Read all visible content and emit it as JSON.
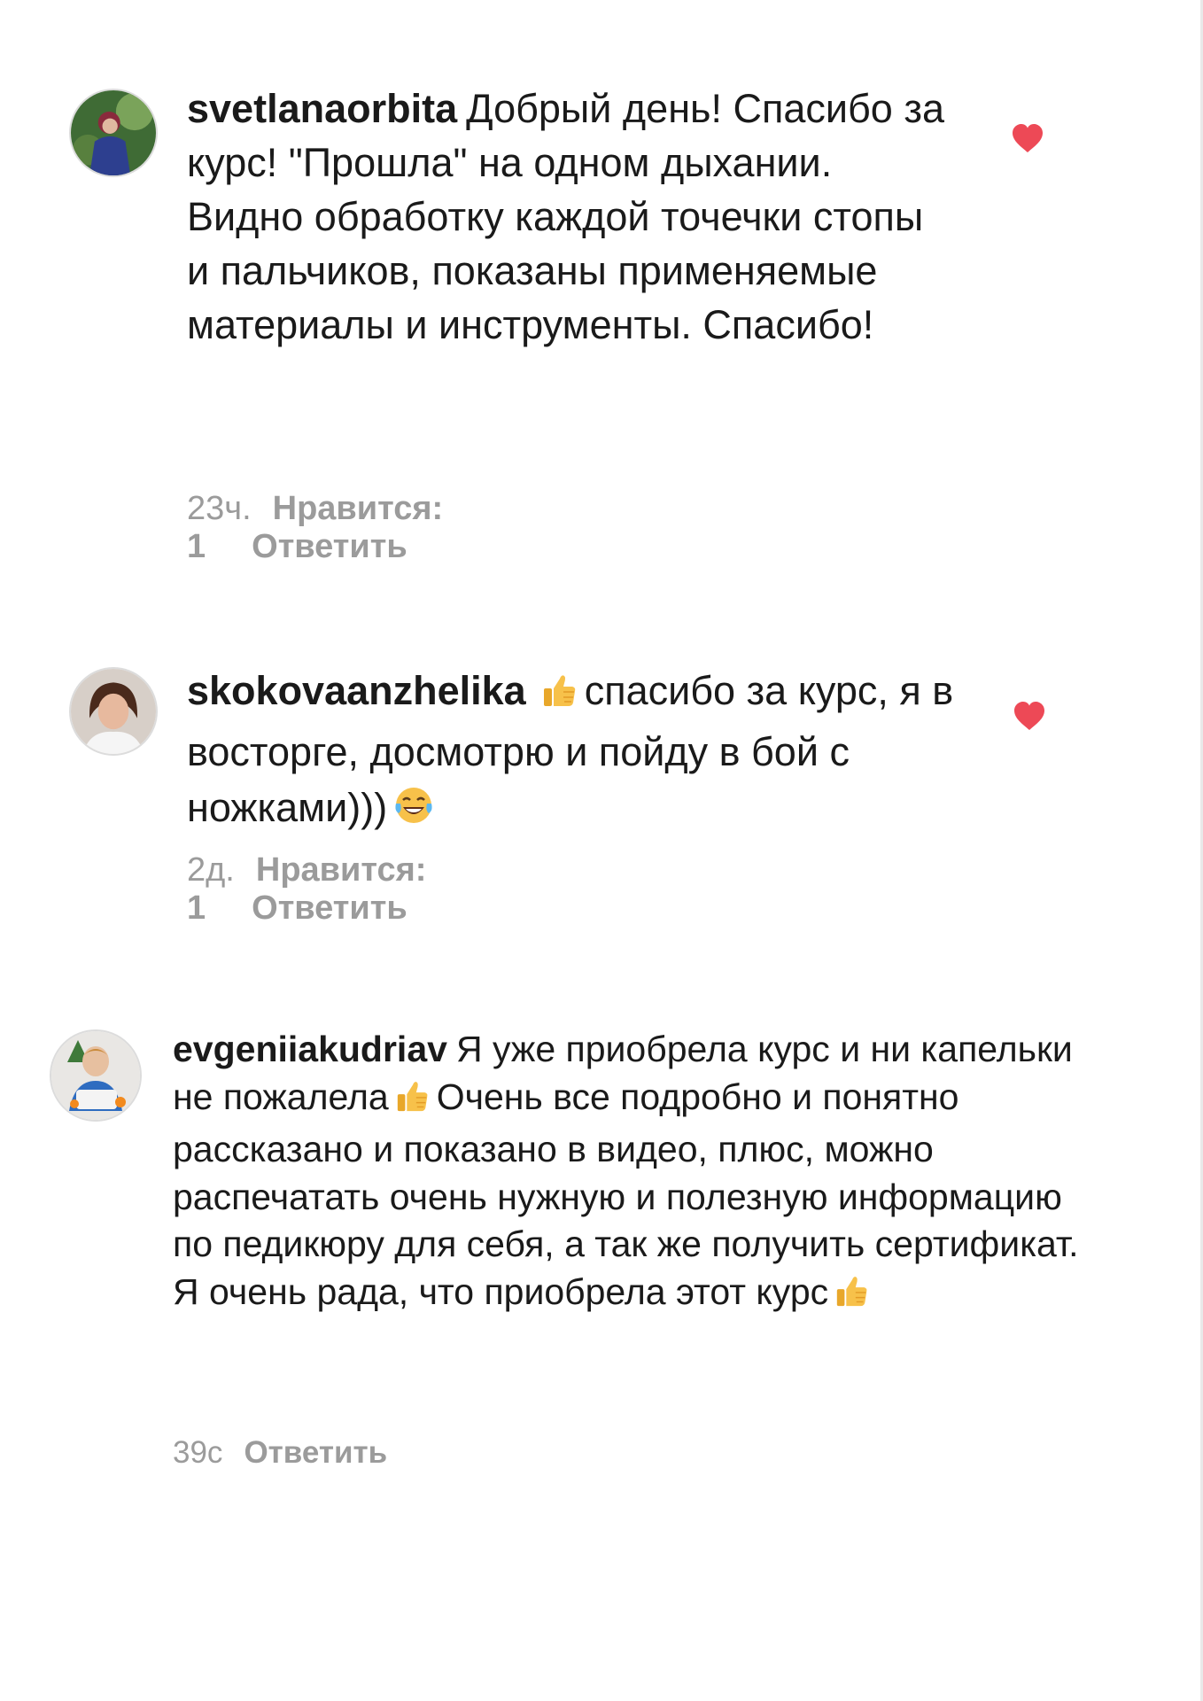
{
  "like_color": "#ed4956",
  "comments": [
    {
      "username": "svetlanaorbita",
      "text": "Добрый день! Спасибо за курс! \"Прошла\" на одном дыхании. Видно обработку каждой точечки стопы и пальчиков, показаны применяемые материалы и инструменты. Спасибо!",
      "time": "23ч.",
      "likes": "Нравится: 1",
      "reply": "Ответить",
      "liked": true
    },
    {
      "username": "skokovaanzhelika",
      "emoji_1": "thumbs-up",
      "text": "спасибо за курс, я в восторге, досмотрю и пойду в бой с ножками)))",
      "emoji_2": "tears-of-joy",
      "time": "2д.",
      "likes": "Нравится: 1",
      "reply": "Ответить",
      "liked": true
    },
    {
      "username": "evgeniiakudriav",
      "text_1": "Я уже приобрела курс и ни капельки не пожалела",
      "emoji_1": "thumbs-up",
      "text_2": "Очень все подробно и понятно рассказано и показано в видео, плюс, можно распечатать очень нужную и полезную информацию по педикюру для себя, а так же получить сертификат. Я очень рада, что приобрела этот курс",
      "emoji_2": "thumbs-up",
      "time": "39с",
      "reply": "Ответить",
      "liked": false
    }
  ]
}
